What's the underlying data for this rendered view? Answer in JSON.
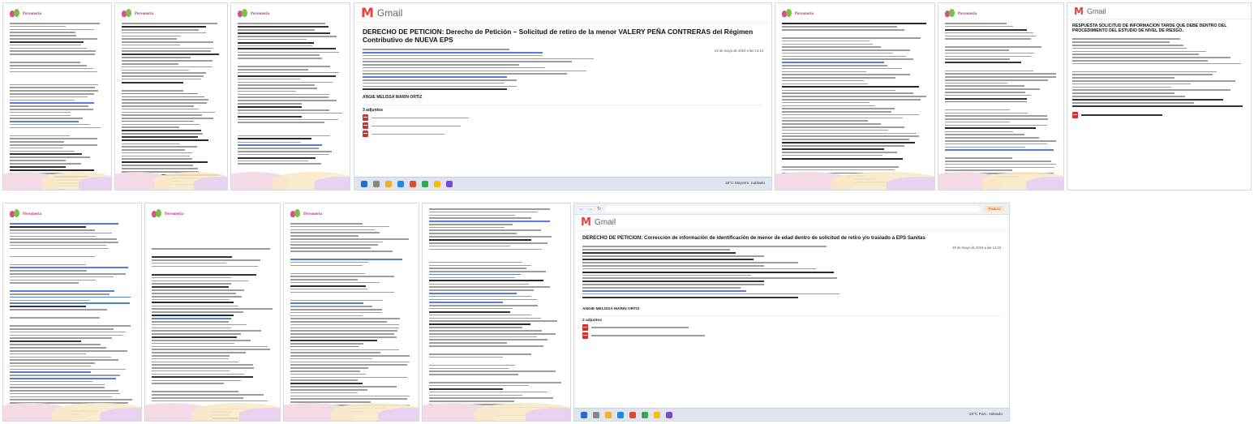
{
  "colors": {
    "gmail_red": "#ea4335",
    "brand_pink": "#d94f8c",
    "brand_green": "#7bbf44",
    "link_blue": "#2a5bd7",
    "pdf_red": "#d93025"
  },
  "icons": [
    "gmail-logo-icon",
    "pdf-icon",
    "windows-start-icon",
    "browser-back-icon",
    "browser-forward-icon",
    "browser-reload-icon"
  ],
  "gmail_top": {
    "logo_name": "Gmail",
    "subject": "DERECHO DE PETICION: Derecho de Petición – Solicitud de retiro de la menor VALERY PEÑA CONTRERAS del Régimen Contributivo de NUEVA EPS",
    "date": "24 de mayo de 2024 a las 14:13",
    "attachments_title": "3 adjuntos",
    "weather": "18°C Mayorm. nublado",
    "signature_name": "ANGIE MELISSA MARIN ORTIZ"
  },
  "gmail_right": {
    "logo_name": "Gmail",
    "subject": "RESPUESTA SOLICITUD DE INFORMACION TARDE QUE DEBE DENTRO DEL PROCEDIMIENTO DEL ESTUDIO DE NIVEL DE RIESGO."
  },
  "gmail_bottom": {
    "logo_name": "Gmail",
    "subject": "DERECHO DE PETICION: Corrección de información de identificación de menor de edad dentro de solicitud de retiro y/o traslado a EPS Sanitas",
    "date": "29 de mayo de 2024 a las 14:23",
    "signature_name": "ANGIE MELISSA MARIN ORTIZ",
    "attachments_title": "2 adjuntos",
    "translate_button": "Traduci",
    "weather": "19°C Parc. soleado"
  }
}
